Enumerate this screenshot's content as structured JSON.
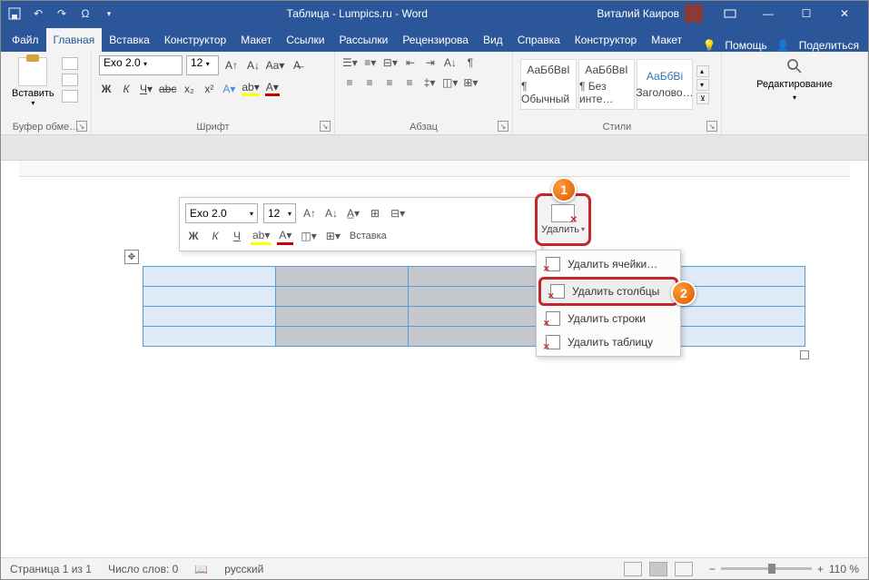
{
  "titlebar": {
    "title": "Таблица - Lumpics.ru - Word",
    "user": "Виталий Каиров"
  },
  "tabs": {
    "file": "Файл",
    "home": "Главная",
    "insert": "Вставка",
    "design": "Конструктор",
    "layout": "Макет",
    "refs": "Ссылки",
    "mail": "Рассылки",
    "review": "Рецензирова",
    "view": "Вид",
    "help": "Справка",
    "tdesign": "Конструктор",
    "tlayout": "Макет",
    "tell": "Помощь",
    "share": "Поделиться"
  },
  "ribbon": {
    "clipboard": {
      "paste": "Вставить",
      "label": "Буфер обме…"
    },
    "font": {
      "name": "Exo 2.0",
      "size": "12",
      "label": "Шрифт"
    },
    "para": {
      "label": "Абзац"
    },
    "styles": {
      "s1": "АаБбВвІ",
      "s1n": "¶ Обычный",
      "s2": "АаБбВвІ",
      "s2n": "¶ Без инте…",
      "s3": "АаБбВі",
      "s3n": "Заголово…",
      "label": "Стили"
    },
    "editing": {
      "label": "Редактирование"
    }
  },
  "mini": {
    "font": "Exo 2.0",
    "size": "12",
    "insert": "Вставка",
    "delete": "Удалить"
  },
  "menu": {
    "cells": "Удалить ячейки…",
    "cols": "Удалить столбцы",
    "rows": "Удалить строки",
    "table": "Удалить таблицу"
  },
  "callout": {
    "one": "1",
    "two": "2"
  },
  "status": {
    "page": "Страница 1 из 1",
    "words": "Число слов: 0",
    "lang": "русский",
    "zoom": "110 %"
  }
}
